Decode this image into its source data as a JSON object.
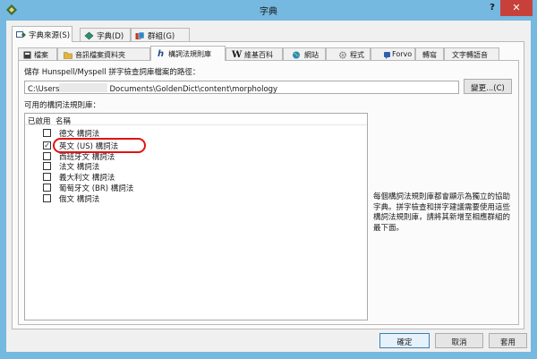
{
  "window": {
    "title": "字典",
    "help_symbol": "?",
    "close_symbol": "✕",
    "icon": "goldendict-icon"
  },
  "outer_tabs": [
    {
      "label": "字典來源(S)",
      "icon": "dictionary-sources-icon"
    },
    {
      "label": "字典(D)",
      "icon": "dictionary-icon"
    },
    {
      "label": "群組(G)",
      "icon": "groups-icon"
    }
  ],
  "inner_tabs": [
    {
      "label": "檔案",
      "icon": "files-icon"
    },
    {
      "label": "音訊檔案資料夾",
      "icon": "folder-icon"
    },
    {
      "label": "構詞法規則庫",
      "icon": "morphology-icon",
      "icon_glyph": "h"
    },
    {
      "label": "維基百科",
      "icon": "wikipedia-icon",
      "icon_glyph": "W"
    },
    {
      "label": "網站",
      "icon": "globe-icon"
    },
    {
      "label": "程式",
      "icon": "gear-icon"
    },
    {
      "label": "Forvo",
      "icon": "forvo-icon"
    },
    {
      "label": "轉寫"
    },
    {
      "label": "文字轉語音"
    }
  ],
  "morphology": {
    "path_label": "儲存 Hunspell/Myspell 拼字檢查詞庫檔案的路徑：",
    "path_prefix": "C:\\Users",
    "path_suffix": "Documents\\GoldenDict\\content\\morphology",
    "browse_label": "變更...(C)",
    "available_label": "可用的構詞法規則庫：",
    "header_enabled": "已啟用",
    "header_name": "名稱",
    "rules": [
      {
        "name": "德文 構詞法",
        "enabled": false
      },
      {
        "name": "英文 (US) 構詞法",
        "enabled": true
      },
      {
        "name": "西班牙文 構詞法",
        "enabled": false
      },
      {
        "name": "法文 構詞法",
        "enabled": false
      },
      {
        "name": "義大利文 構詞法",
        "enabled": false
      },
      {
        "name": "葡萄牙文 (BR) 構詞法",
        "enabled": false
      },
      {
        "name": "俄文 構詞法",
        "enabled": false
      }
    ],
    "checkmark": "✓",
    "description": "每個構詞法規則庫都會顯示為獨立的協助字典。拼字檢查和拼字建議需要使用這些構詞法規則庫，請將其新增至相應群組的最下面。"
  },
  "footer": {
    "ok_label": "確定",
    "cancel_label": "取消",
    "apply_label": "套用"
  },
  "colors": {
    "title_bar": "#75b8e0",
    "close_button": "#c7413a",
    "highlight_ring": "#e11313",
    "panel_background": "#f0f0f0"
  }
}
